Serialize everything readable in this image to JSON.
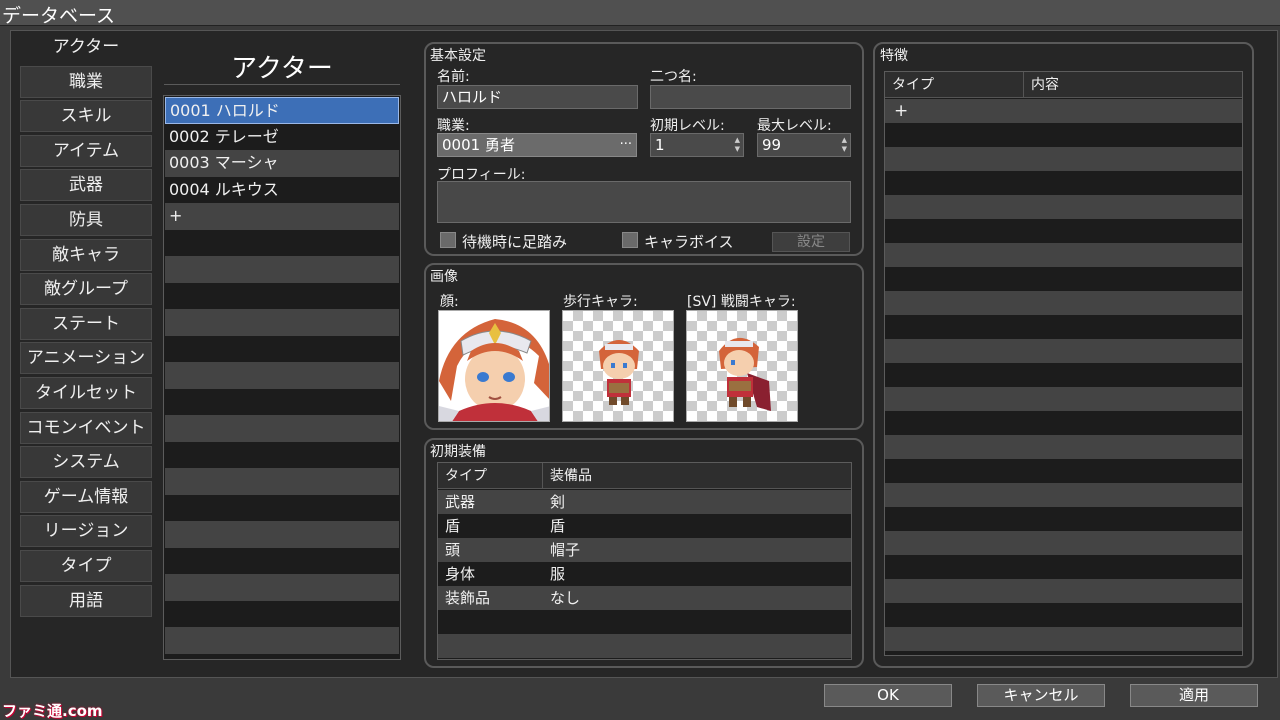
{
  "window": {
    "title": "データベース"
  },
  "tabs": [
    {
      "label": "アクター",
      "active": true
    },
    {
      "label": "職業"
    },
    {
      "label": "スキル"
    },
    {
      "label": "アイテム"
    },
    {
      "label": "武器"
    },
    {
      "label": "防具"
    },
    {
      "label": "敵キャラ"
    },
    {
      "label": "敵グループ"
    },
    {
      "label": "ステート"
    },
    {
      "label": "アニメーション"
    },
    {
      "label": "タイルセット"
    },
    {
      "label": "コモンイベント"
    },
    {
      "label": "システム"
    },
    {
      "label": "ゲーム情報"
    },
    {
      "label": "リージョン"
    },
    {
      "label": "タイプ"
    },
    {
      "label": "用語"
    }
  ],
  "actor_list": {
    "title": "アクター",
    "items": [
      "0001 ハロルド",
      "0002 テレーゼ",
      "0003 マーシャ",
      "0004 ルキウス",
      "+"
    ],
    "selected_index": 0
  },
  "basic": {
    "title": "基本設定",
    "name_label": "名前:",
    "name_value": "ハロルド",
    "nickname_label": "二つ名:",
    "nickname_value": "",
    "class_label": "職業:",
    "class_value": "0001 勇者",
    "class_dots": "···",
    "initial_level_label": "初期レベル:",
    "initial_level_value": "1",
    "max_level_label": "最大レベル:",
    "max_level_value": "99",
    "profile_label": "プロフィール:",
    "profile_value": "",
    "stepping_label": "待機時に足踏み",
    "voice_label": "キャラボイス",
    "settings_button": "設定"
  },
  "images": {
    "title": "画像",
    "face_label": "顔:",
    "walk_label": "歩行キャラ:",
    "battler_label": "[SV] 戦闘キャラ:"
  },
  "equipment": {
    "title": "初期装備",
    "headers": [
      "タイプ",
      "装備品"
    ],
    "rows": [
      [
        "武器",
        "剣"
      ],
      [
        "盾",
        "盾"
      ],
      [
        "頭",
        "帽子"
      ],
      [
        "身体",
        "服"
      ],
      [
        "装飾品",
        "なし"
      ]
    ]
  },
  "traits": {
    "title": "特徴",
    "headers": [
      "タイプ",
      "内容"
    ],
    "add_symbol": "+"
  },
  "footer": {
    "ok": "OK",
    "cancel": "キャンセル",
    "apply": "適用"
  },
  "watermark": "ファミ通.com",
  "colors": {
    "selection": "#3d6fb7",
    "background": "#262626"
  }
}
